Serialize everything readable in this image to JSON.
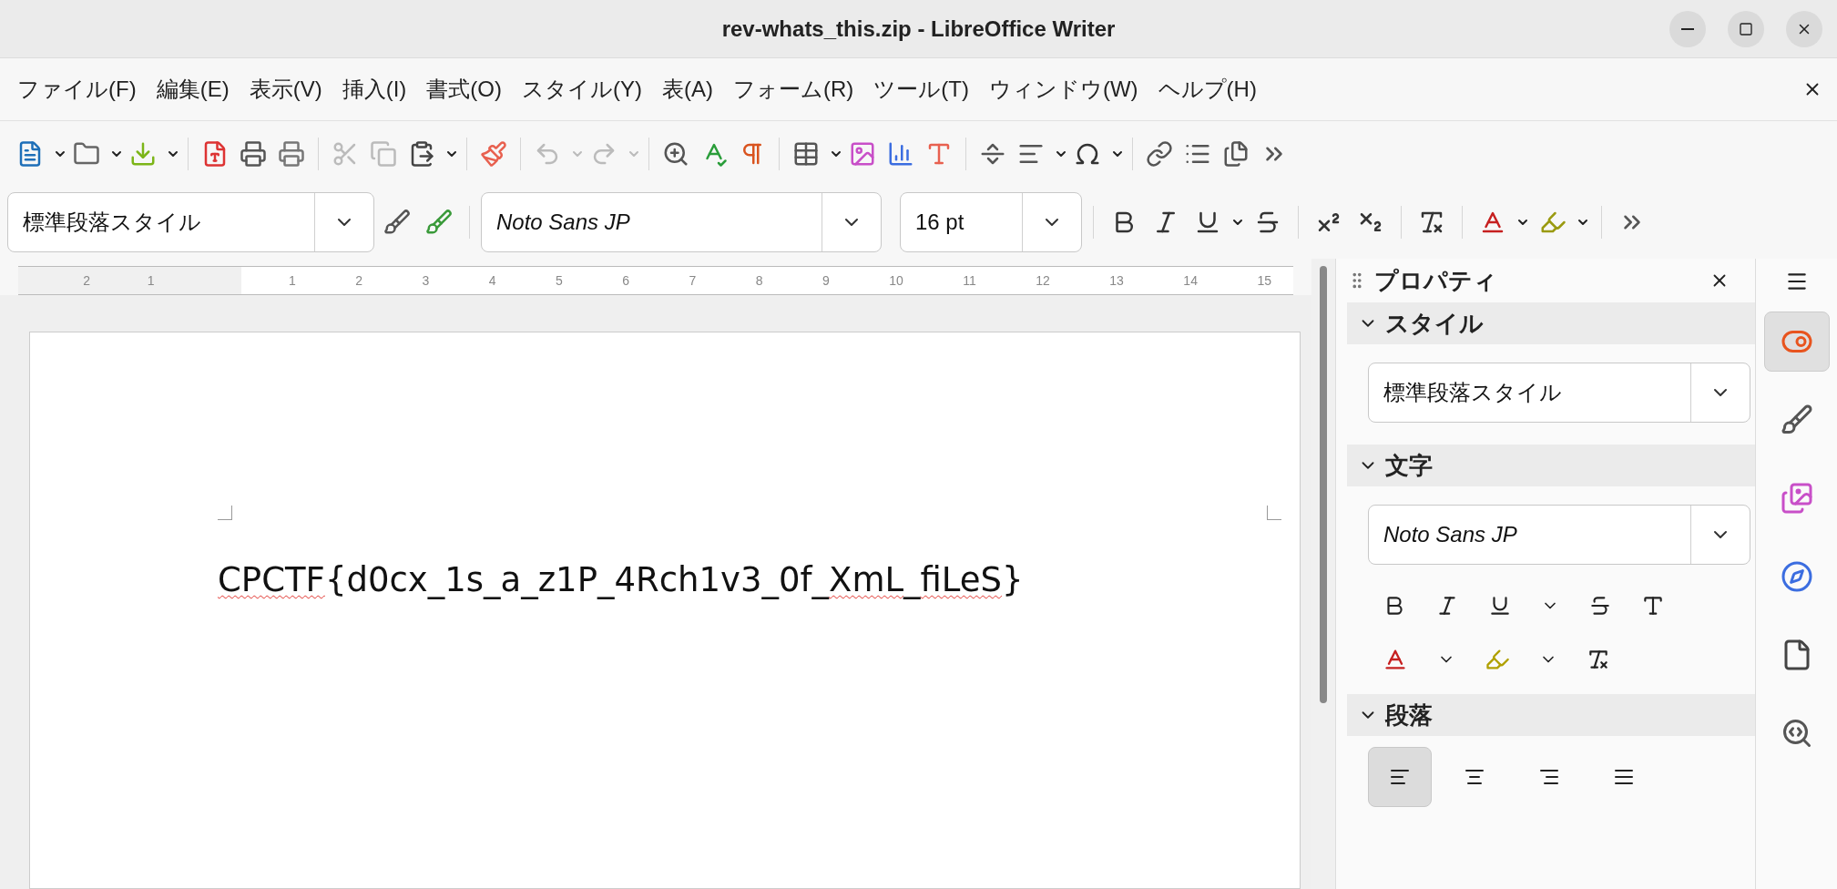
{
  "window": {
    "title": "rev-whats_this.zip - LibreOffice Writer"
  },
  "menu": [
    "ファイル(F)",
    "編集(E)",
    "表示(V)",
    "挿入(I)",
    "書式(O)",
    "スタイル(Y)",
    "表(A)",
    "フォーム(R)",
    "ツール(T)",
    "ウィンドウ(W)",
    "ヘルプ(H)"
  ],
  "formatting": {
    "paragraph_style": "標準段落スタイル",
    "font_name": "Noto Sans JP",
    "font_size": "16 pt"
  },
  "ruler": {
    "left_labels": [
      "2",
      "1"
    ],
    "right_labels": [
      "1",
      "2",
      "3",
      "4",
      "5",
      "6",
      "7",
      "8",
      "9",
      "10",
      "11",
      "12",
      "13",
      "14",
      "15"
    ]
  },
  "document": {
    "segments": [
      {
        "word": "CPCTF",
        "misspelled": true,
        "after": "{d0cx_1s_a_z1P_4Rch1v3_0f_"
      },
      {
        "word": "XmL",
        "misspelled": true,
        "after": "_"
      },
      {
        "word": "fiLeS",
        "misspelled": true,
        "after": "}"
      }
    ]
  },
  "sidebar": {
    "title": "プロパティ",
    "sections": [
      {
        "kind": "style",
        "title": "スタイル",
        "expanded": true,
        "value": "標準段落スタイル"
      },
      {
        "kind": "character",
        "title": "文字",
        "expanded": true,
        "value": "Noto Sans JP"
      },
      {
        "kind": "paragraph",
        "title": "段落",
        "expanded": true,
        "alignments": [
          {
            "kind": "left",
            "selected": true
          },
          {
            "kind": "center",
            "selected": false
          },
          {
            "kind": "right",
            "selected": false
          },
          {
            "kind": "justify",
            "selected": false
          }
        ]
      }
    ],
    "tabs": [
      {
        "kind": "properties",
        "selected": true
      },
      {
        "kind": "styles",
        "selected": false
      },
      {
        "kind": "gallery",
        "selected": false
      },
      {
        "kind": "navigator",
        "selected": false
      },
      {
        "kind": "page",
        "selected": false
      },
      {
        "kind": "style-inspector",
        "selected": false
      }
    ]
  }
}
